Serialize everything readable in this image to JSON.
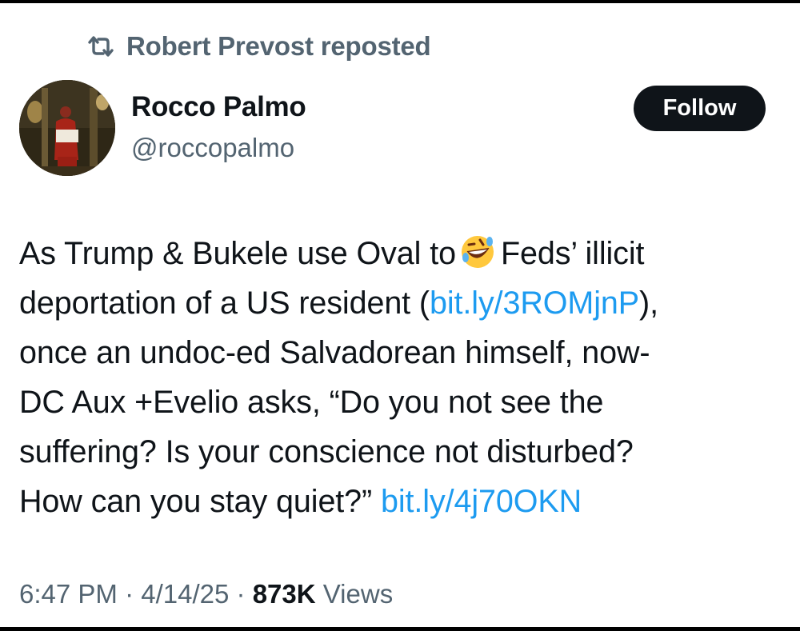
{
  "repost": {
    "icon": "repost-icon",
    "text": "Robert Prevost reposted"
  },
  "author": {
    "name": "Rocco Palmo",
    "handle": "@roccopalmo",
    "avatar": "avatar-cardinal-photo"
  },
  "follow_label": "Follow",
  "tweet": {
    "line1_pre": "As Trump & Bukele use Oval to",
    "line1_emoji": "rolling-on-floor-laughing-emoji",
    "line1_post": "Feds’ illicit",
    "line2_pre": "deportation of a US resident (",
    "line2_link": "bit.ly/3ROMjnP",
    "line2_post": "),",
    "line3": "once an undoc-ed Salvadorean himself, now-",
    "line4": "DC Aux +Evelio asks, “Do you not see the",
    "line5": "suffering? Is your conscience not disturbed?",
    "line6_pre": "How can you stay quiet?”",
    "line6_link": "bit.ly/4j70OKN"
  },
  "meta": {
    "time": "6:47 PM",
    "date": "4/14/25",
    "separator": "·",
    "views_count": "873K",
    "views_label": "Views"
  },
  "colors": {
    "text": "#0f1419",
    "secondary": "#536471",
    "link": "#1d9bf0",
    "button_bg": "#0f1419",
    "button_text": "#ffffff"
  }
}
